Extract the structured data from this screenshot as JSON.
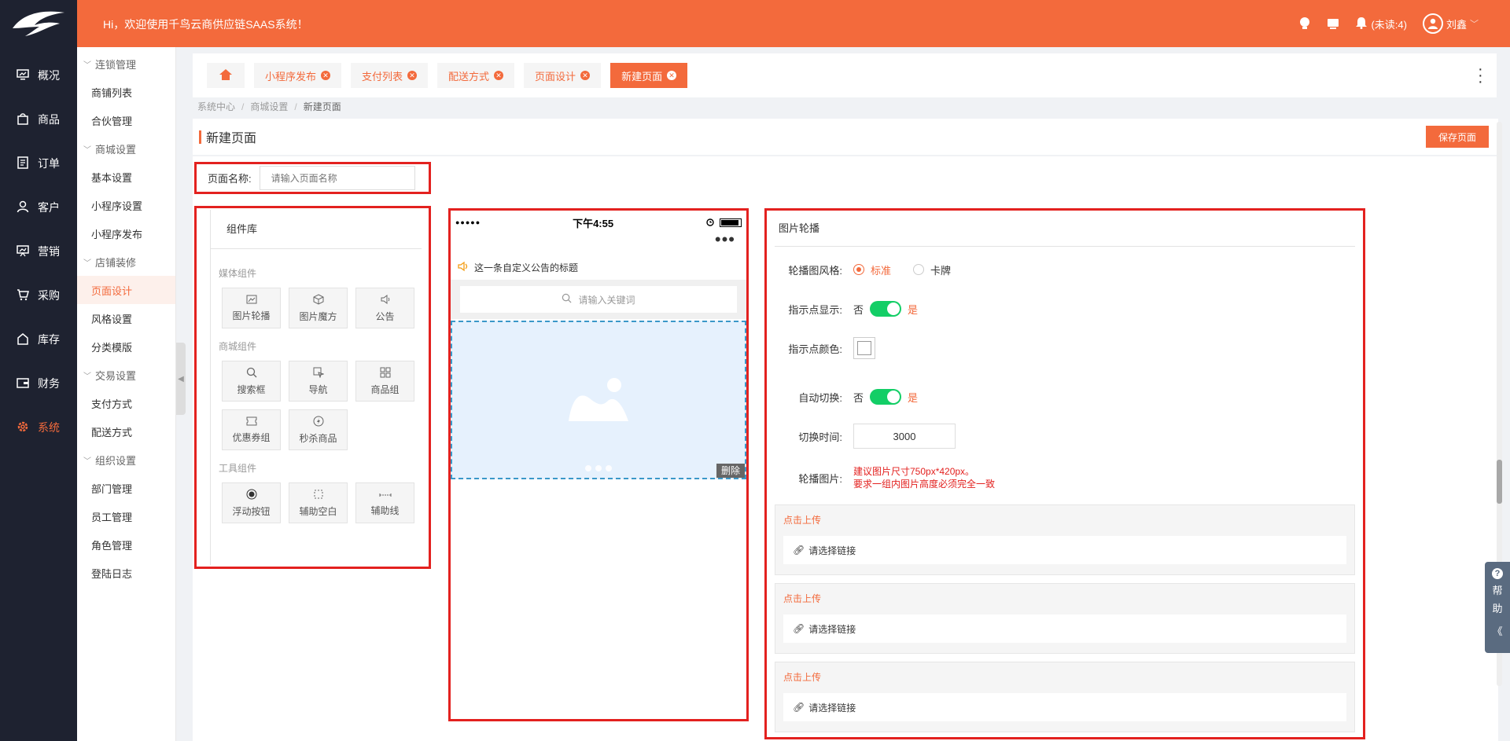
{
  "header": {
    "welcome": "Hi，欢迎使用千鸟云商供应链SAAS系统！",
    "unread": "(未读:4)",
    "username": "刘鑫"
  },
  "sidebar": {
    "items": [
      {
        "label": "概况",
        "icon": "monitor-icon"
      },
      {
        "label": "商品",
        "icon": "shopping-bag-icon"
      },
      {
        "label": "订单",
        "icon": "document-icon"
      },
      {
        "label": "客户",
        "icon": "user-icon"
      },
      {
        "label": "营销",
        "icon": "presentation-icon"
      },
      {
        "label": "采购",
        "icon": "cart-icon"
      },
      {
        "label": "库存",
        "icon": "home-icon"
      },
      {
        "label": "财务",
        "icon": "wallet-icon"
      },
      {
        "label": "系统",
        "icon": "gear-icon"
      }
    ]
  },
  "subnav": {
    "g1": "连锁管理",
    "g1_items": [
      "商铺列表",
      "合伙管理"
    ],
    "g2": "商城设置",
    "g2_items": [
      "基本设置",
      "小程序设置",
      "小程序发布"
    ],
    "g3": "店铺装修",
    "g3_items": [
      "页面设计",
      "风格设置",
      "分类模版"
    ],
    "g4": "交易设置",
    "g4_items": [
      "支付方式",
      "配送方式"
    ],
    "g5": "组织设置",
    "g5_items": [
      "部门管理",
      "员工管理",
      "角色管理",
      "登陆日志"
    ]
  },
  "tabs": [
    "小程序发布",
    "支付列表",
    "配送方式",
    "页面设计",
    "新建页面"
  ],
  "breadcrumb": [
    "系统中心",
    "商城设置",
    "新建页面"
  ],
  "page": {
    "title": "新建页面",
    "save_label": "保存页面",
    "name_label": "页面名称:",
    "name_placeholder": "请输入页面名称"
  },
  "library": {
    "title": "组件库",
    "media_title": "媒体组件",
    "media": [
      "图片轮播",
      "图片魔方",
      "公告"
    ],
    "mall_title": "商城组件",
    "mall": [
      "搜索框",
      "导航",
      "商品组",
      "优惠券组",
      "秒杀商品"
    ],
    "tool_title": "工具组件",
    "tools": [
      "浮动按钮",
      "辅助空白",
      "辅助线"
    ]
  },
  "phone": {
    "signal": "●●●●●",
    "time": "下午4:55",
    "dots": "•••",
    "notice": "这一条自定义公告的标题",
    "search_placeholder": "请输入关键词",
    "delete": "删除"
  },
  "props": {
    "title": "图片轮播",
    "style_label": "轮播图风格:",
    "style_opt1": "标准",
    "style_opt2": "卡牌",
    "indicator_label": "指示点显示:",
    "no": "否",
    "yes": "是",
    "indicator_color_label": "指示点颜色:",
    "autoplay_label": "自动切换:",
    "interval_label": "切换时间:",
    "interval_value": "3000",
    "images_label": "轮播图片:",
    "hint1": "建议图片尺寸750px*420px。",
    "hint2": "要求一组内图片高度必须完全一致",
    "upload_label": "点击上传",
    "link_placeholder": "请选择链接"
  },
  "help": {
    "c1": "帮",
    "c2": "助",
    "chev": "《"
  }
}
